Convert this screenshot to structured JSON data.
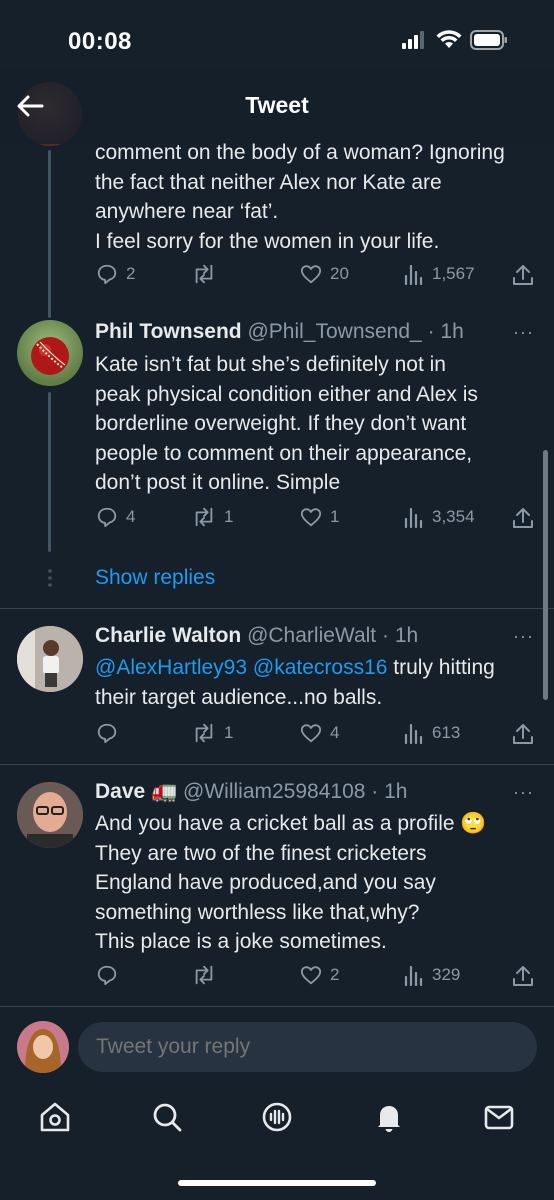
{
  "status_bar": {
    "time": "00:08"
  },
  "header": {
    "title": "Tweet"
  },
  "tweets": [
    {
      "body_lines": [
        "comment on the body of a woman? Ignoring",
        "the fact that neither Alex nor Kate are",
        "anywhere near ‘fat’.",
        "I feel sorry for the women in your life."
      ],
      "stats": {
        "replies": "2",
        "retweets": "",
        "likes": "20",
        "views": "1,567"
      }
    },
    {
      "name": "Phil Townsend",
      "handle": "@Phil_Townsend_",
      "time": "· 1h",
      "body_lines": [
        "Kate isn’t fat but she’s definitely not in",
        "peak physical condition either and Alex is",
        "borderline overweight. If they don’t want",
        "people to comment on their appearance,",
        "don’t post it online. Simple"
      ],
      "stats": {
        "replies": "4",
        "retweets": "1",
        "likes": "1",
        "views": "3,354"
      }
    },
    {
      "name": "Charlie Walton",
      "handle": "@CharlieWalt",
      "time": "· 1h",
      "mention_1": "@AlexHartley93",
      "mention_2": "@katecross16",
      "body_tail": " truly hitting",
      "body_line2": "their target audience...no balls.",
      "stats": {
        "replies": "",
        "retweets": "1",
        "likes": "4",
        "views": "613"
      }
    },
    {
      "name": "Dave 🚛",
      "handle": "@William25984108",
      "time": "· 1h",
      "body_lines": [
        "And you have a cricket ball as a profile 🙄",
        "They are two of the finest cricketers",
        "England have produced,and you say",
        "something worthless like that,why?",
        "This place is a joke sometimes."
      ],
      "stats": {
        "replies": "",
        "retweets": "",
        "likes": "2",
        "views": "329"
      }
    }
  ],
  "show_replies": "Show replies",
  "more_glyph": "···",
  "reply_placeholder": "Tweet your reply",
  "icons": [
    "back-arrow-icon",
    "reply-icon",
    "retweet-icon",
    "like-icon",
    "views-icon",
    "share-icon",
    "home-icon",
    "search-icon",
    "spaces-icon",
    "notifications-icon",
    "messages-icon"
  ],
  "colors": {
    "background": "#15202b",
    "accent": "#1d9bf0",
    "muted": "#8b98a5"
  }
}
